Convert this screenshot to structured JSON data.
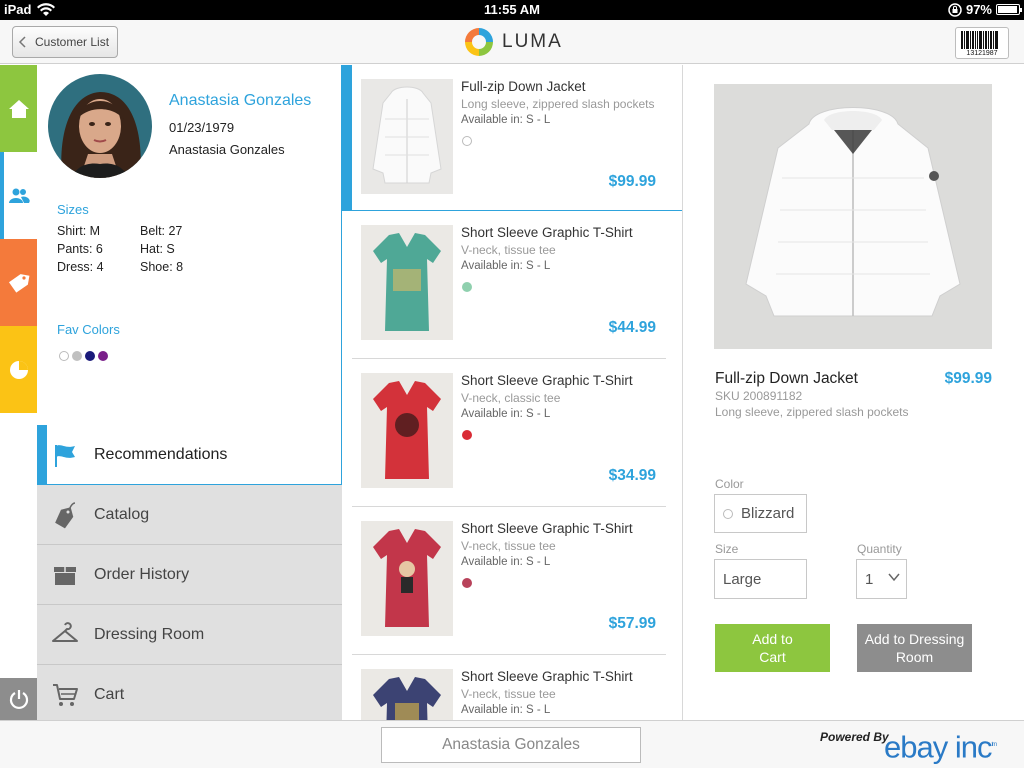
{
  "status_bar": {
    "carrier": "iPad",
    "time": "11:55 AM",
    "battery": "97%",
    "battery_level": 0.97
  },
  "header": {
    "back_label": "Customer List",
    "logo_text": "LUMA",
    "barcode_number": "13121987"
  },
  "customer": {
    "name": "Anastasia Gonzales",
    "dob": "01/23/1979",
    "name_secondary": "Anastasia Gonzales",
    "sizes_title": "Sizes",
    "sizes": [
      {
        "label": "Shirt: M"
      },
      {
        "label": "Belt: 27"
      },
      {
        "label": "Pants: 6"
      },
      {
        "label": "Hat: S"
      },
      {
        "label": "Dress: 4"
      },
      {
        "label": "Shoe: 8"
      }
    ],
    "fav_colors_title": "Fav Colors",
    "fav_colors": [
      "#ffffff",
      "#c0c0c0",
      "#1a1a7a",
      "#7a1f8a"
    ]
  },
  "nav": {
    "items": [
      {
        "label": "Recommendations",
        "icon": "flag-icon",
        "active": true
      },
      {
        "label": "Catalog",
        "icon": "tag-icon"
      },
      {
        "label": "Order History",
        "icon": "box-icon"
      },
      {
        "label": "Dressing Room",
        "icon": "hanger-icon"
      },
      {
        "label": "Cart",
        "icon": "cart-icon"
      }
    ]
  },
  "products": [
    {
      "name": "Full-zip Down Jacket",
      "desc": "Long sleeve, zippered slash pockets",
      "avail": "Available in: S - L",
      "dot": "#ffffff",
      "price": "$99.99"
    },
    {
      "name": "Short Sleeve Graphic T-Shirt",
      "desc": "V-neck, tissue tee",
      "avail": "Available in: S - L",
      "dot": "#8fd0ae",
      "price": "$44.99"
    },
    {
      "name": "Short Sleeve Graphic T-Shirt",
      "desc": "V-neck, classic tee",
      "avail": "Available in: S - L",
      "dot": "#d92b35",
      "price": "$34.99"
    },
    {
      "name": "Short Sleeve Graphic T-Shirt",
      "desc": "V-neck, tissue tee",
      "avail": "Available in: S - L",
      "dot": "#b8425a",
      "price": "$57.99"
    },
    {
      "name": "Short Sleeve Graphic T-Shirt",
      "desc": "V-neck, tissue tee",
      "avail": "Available in: S - L",
      "dot": "",
      "price": ""
    }
  ],
  "detail": {
    "name": "Full-zip Down Jacket",
    "price": "$99.99",
    "sku": "SKU 200891182",
    "desc": "Long sleeve, zippered slash pockets",
    "color_label": "Color",
    "color_value": "Blizzard",
    "size_label": "Size",
    "size_value": "Large",
    "qty_label": "Quantity",
    "qty_value": "1",
    "add_to_cart": "Add to Cart",
    "add_to_dressing_room": "Add to Dressing Room"
  },
  "footer": {
    "customer_name": "Anastasia Gonzales",
    "powered_by": "Powered By",
    "brand": "ebay inc",
    "brand_tm": "tm"
  },
  "colors": {
    "accent_blue": "#2ea3dc",
    "green": "#8dc63f",
    "orange": "#f47a3b",
    "yellow": "#fbc315",
    "gray": "#8d8d8d"
  }
}
